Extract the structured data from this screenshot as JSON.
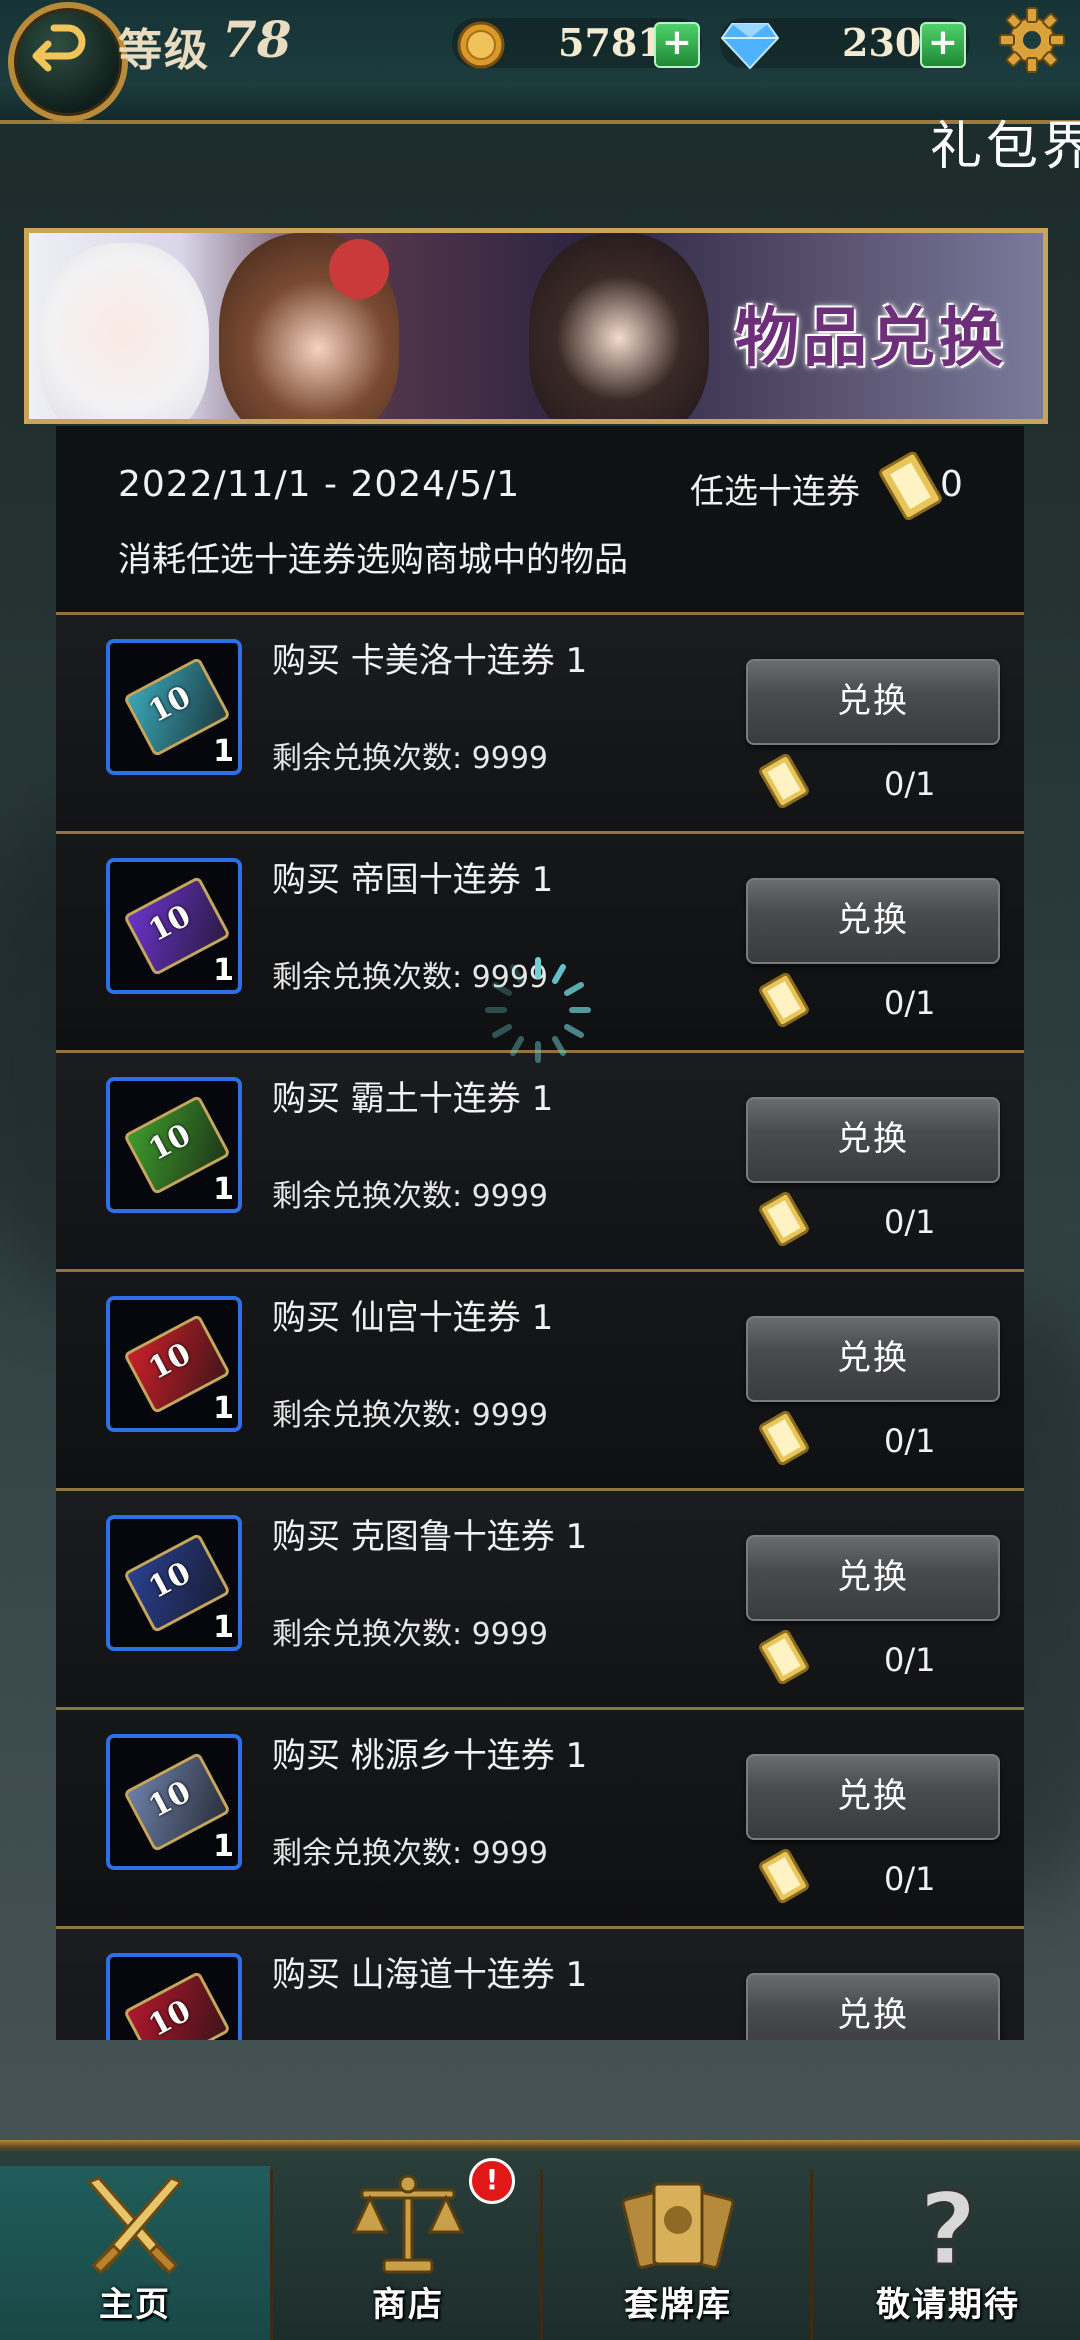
{
  "header": {
    "level_label": "等级",
    "level_value": "78",
    "gold": "5781",
    "diamonds": "230",
    "section_title": "礼包界"
  },
  "banner": {
    "title": "物品兑换"
  },
  "exchange": {
    "date_range": "2022/11/1 - 2024/5/1",
    "ticket_label": "任选十连券",
    "ticket_count": "0",
    "description": "消耗任选十连券选购商城中的物品",
    "button_label": "兑换"
  },
  "items": [
    {
      "name": "购买 卡美洛十连券 1",
      "remain": "剩余兑换次数: 9999",
      "qty": "1",
      "cost": "0/1",
      "color": "#3aa6b8"
    },
    {
      "name": "购买 帝国十连券 1",
      "remain": "剩余兑换次数: 9999",
      "qty": "1",
      "cost": "0/1",
      "color": "#6b33c9"
    },
    {
      "name": "购买 霸土十连券 1",
      "remain": "剩余兑换次数: 9999",
      "qty": "1",
      "cost": "0/1",
      "color": "#3f9a2c"
    },
    {
      "name": "购买 仙宫十连券 1",
      "remain": "剩余兑换次数: 9999",
      "qty": "1",
      "cost": "0/1",
      "color": "#c8202a"
    },
    {
      "name": "购买 克图鲁十连券 1",
      "remain": "剩余兑换次数: 9999",
      "qty": "1",
      "cost": "0/1",
      "color": "#2a3f8f"
    },
    {
      "name": "购买 桃源乡十连券 1",
      "remain": "剩余兑换次数: 9999",
      "qty": "1",
      "cost": "0/1",
      "color": "#6c7fa8"
    },
    {
      "name": "购买 山海道十连券 1",
      "remain": "",
      "qty": "",
      "cost": "",
      "color": "#b0182c"
    }
  ],
  "nav": {
    "home": "主页",
    "shop": "商店",
    "deck": "套牌库",
    "coming": "敬请期待",
    "shop_badge": "!"
  }
}
